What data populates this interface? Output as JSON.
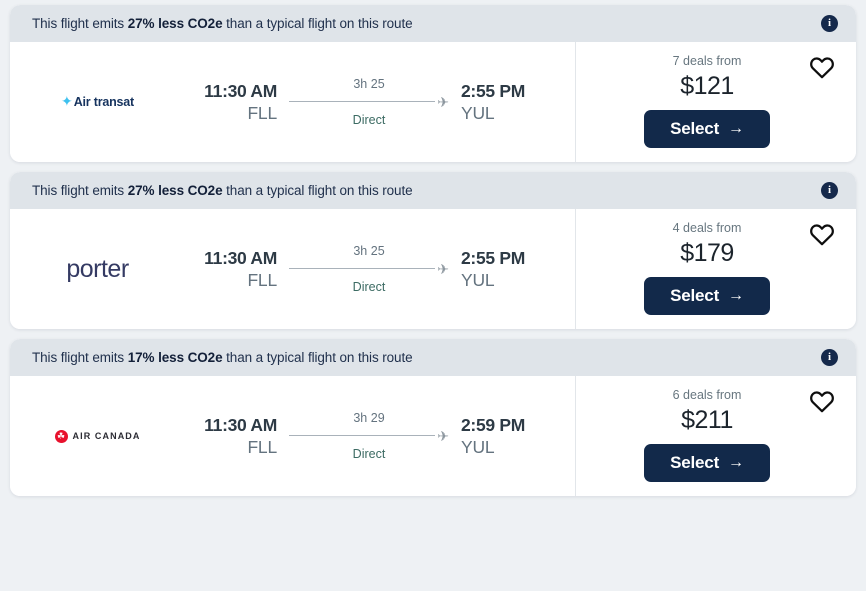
{
  "page": {
    "background_color": "#eef1f4",
    "accent_color": "#12294a",
    "banner_color": "#dfe4e9"
  },
  "icons": {
    "info": "i",
    "plane": "✈",
    "arrow_right": "→",
    "maple_leaf": "☘",
    "transat_star": "✦"
  },
  "flights": [
    {
      "eco": {
        "prefix": "This flight emits ",
        "highlight": "27% less CO2e",
        "suffix": " than a typical flight on this route"
      },
      "airline": {
        "name": "Air transat",
        "logo_type": "air-transat",
        "logo_text": "Air transat",
        "mark_color": "#3ec1ef",
        "text_color": "#16335e"
      },
      "depart_time": "11:30 AM",
      "depart_code": "FLL",
      "duration": "3h 25",
      "stops": "Direct",
      "arrive_time": "2:55 PM",
      "arrive_code": "YUL",
      "deals_label": "7 deals from",
      "price": "$121",
      "select_label": "Select"
    },
    {
      "eco": {
        "prefix": "This flight emits ",
        "highlight": "27% less CO2e",
        "suffix": " than a typical flight on this route"
      },
      "airline": {
        "name": "porter",
        "logo_type": "porter",
        "logo_text": "porter",
        "mark_color": "#343a63",
        "text_color": "#343a63"
      },
      "depart_time": "11:30 AM",
      "depart_code": "FLL",
      "duration": "3h 25",
      "stops": "Direct",
      "arrive_time": "2:55 PM",
      "arrive_code": "YUL",
      "deals_label": "4 deals from",
      "price": "$179",
      "select_label": "Select"
    },
    {
      "eco": {
        "prefix": "This flight emits ",
        "highlight": "17% less CO2e",
        "suffix": " than a typical flight on this route"
      },
      "airline": {
        "name": "Air Canada",
        "logo_type": "air-canada",
        "logo_text": "AIR CANADA",
        "mark_color": "#e8112d",
        "text_color": "#2b2b33"
      },
      "depart_time": "11:30 AM",
      "depart_code": "FLL",
      "duration": "3h 29",
      "stops": "Direct",
      "arrive_time": "2:59 PM",
      "arrive_code": "YUL",
      "deals_label": "6 deals from",
      "price": "$211",
      "select_label": "Select"
    }
  ]
}
